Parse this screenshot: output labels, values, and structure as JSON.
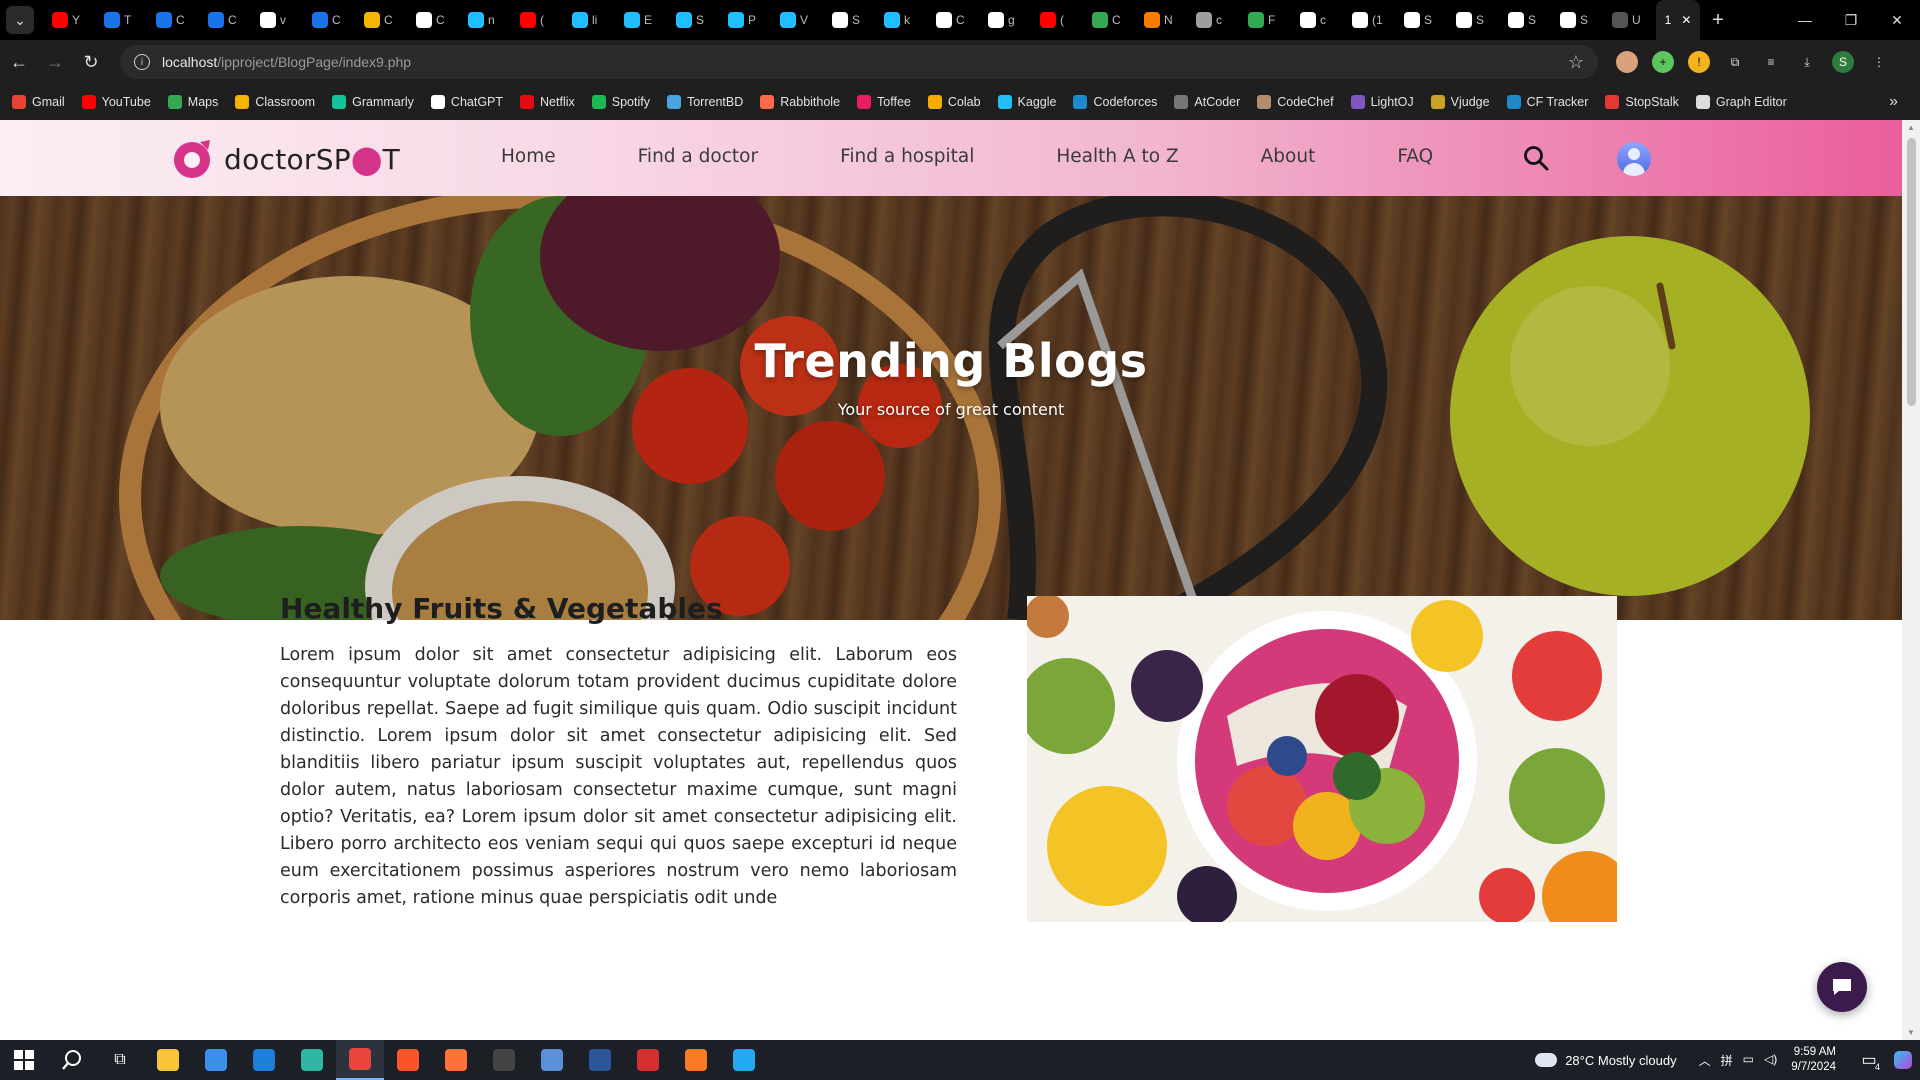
{
  "browser": {
    "tabs": [
      {
        "letter": "Y",
        "color": "#ff0000"
      },
      {
        "letter": "T",
        "color": "#1a73e8"
      },
      {
        "letter": "C",
        "color": "#1a73e8"
      },
      {
        "letter": "C",
        "color": "#1a73e8"
      },
      {
        "letter": "v",
        "color": "#ffffff"
      },
      {
        "letter": "C",
        "color": "#1a73e8"
      },
      {
        "letter": "C",
        "color": "#f4b400"
      },
      {
        "letter": "C",
        "color": "#ffffff"
      },
      {
        "letter": "n",
        "color": "#20beff"
      },
      {
        "letter": "(",
        "color": "#ff0000"
      },
      {
        "letter": "li",
        "color": "#20beff"
      },
      {
        "letter": "E",
        "color": "#20beff"
      },
      {
        "letter": "S",
        "color": "#20beff"
      },
      {
        "letter": "P",
        "color": "#20beff"
      },
      {
        "letter": "V",
        "color": "#20beff"
      },
      {
        "letter": "S",
        "color": "#ffffff"
      },
      {
        "letter": "k",
        "color": "#20beff"
      },
      {
        "letter": "C",
        "color": "#ffffff"
      },
      {
        "letter": "g",
        "color": "#ffffff"
      },
      {
        "letter": "(",
        "color": "#ff0000"
      },
      {
        "letter": "C",
        "color": "#34a853"
      },
      {
        "letter": "N",
        "color": "#f57c00"
      },
      {
        "letter": "c",
        "color": "#9e9e9e"
      },
      {
        "letter": "F",
        "color": "#34a853"
      },
      {
        "letter": "c",
        "color": "#ffffff"
      },
      {
        "letter": "(1",
        "color": "#ffffff"
      },
      {
        "letter": "S",
        "color": "#ffffff"
      },
      {
        "letter": "S",
        "color": "#ffffff"
      },
      {
        "letter": "S",
        "color": "#ffffff"
      },
      {
        "letter": "S",
        "color": "#ffffff"
      },
      {
        "letter": "U",
        "color": "#555555"
      }
    ],
    "active_tab": "1",
    "address": {
      "host": "localhost",
      "path": "/ipproject/BlogPage/index9.php"
    },
    "bookmarks": [
      {
        "label": "Gmail",
        "color": "#ea4335"
      },
      {
        "label": "YouTube",
        "color": "#ff0000"
      },
      {
        "label": "Maps",
        "color": "#34a853"
      },
      {
        "label": "Classroom",
        "color": "#f4b400"
      },
      {
        "label": "Grammarly",
        "color": "#15c39a"
      },
      {
        "label": "ChatGPT",
        "color": "#ffffff"
      },
      {
        "label": "Netflix",
        "color": "#e50914"
      },
      {
        "label": "Spotify",
        "color": "#1db954"
      },
      {
        "label": "TorrentBD",
        "color": "#4aa3df"
      },
      {
        "label": "Rabbithole",
        "color": "#ff6b4a"
      },
      {
        "label": "Toffee",
        "color": "#e91e63"
      },
      {
        "label": "Colab",
        "color": "#f9ab00"
      },
      {
        "label": "Kaggle",
        "color": "#20beff"
      },
      {
        "label": "Codeforces",
        "color": "#1f8acb"
      },
      {
        "label": "AtCoder",
        "color": "#777777"
      },
      {
        "label": "CodeChef",
        "color": "#b38b6d"
      },
      {
        "label": "LightOJ",
        "color": "#7e57c2"
      },
      {
        "label": "Vjudge",
        "color": "#c9a227"
      },
      {
        "label": "CF Tracker",
        "color": "#1f8acb"
      },
      {
        "label": "StopStalk",
        "color": "#e53935"
      },
      {
        "label": "Graph Editor",
        "color": "#dddddd"
      }
    ]
  },
  "site": {
    "logo": {
      "text_before": "doctorSP",
      "text_after": "T",
      "brand_color": "#d6338a"
    },
    "nav": [
      "Home",
      "Find a doctor",
      "Find a hospital",
      "Health A to Z",
      "About",
      "FAQ"
    ],
    "hero": {
      "title": "Trending Blogs",
      "subtitle": "Your source of great content"
    },
    "article": {
      "title": "Healthy Fruits & Vegetables",
      "body": "Lorem ipsum dolor sit amet consectetur adipisicing elit. Laborum eos consequuntur voluptate dolorum totam provident ducimus cupiditate dolore doloribus repellat. Saepe ad fugit similique quis quam. Odio suscipit incidunt distinctio. Lorem ipsum dolor sit amet consectetur adipisicing elit. Sed blanditiis libero pariatur ipsum suscipit voluptates aut, repellendus quos dolor autem, natus laboriosam consectetur maxime cumque, sunt magni optio? Veritatis, ea? Lorem ipsum dolor sit amet consectetur adipisicing elit. Libero porro architecto eos veniam sequi qui quos saepe excepturi id neque eum exercitationem possimus asperiores nostrum vero nemo laboriosam corporis amet, ratione minus quae perspiciatis odit unde"
    }
  },
  "taskbar": {
    "weather": "28°C  Mostly cloudy",
    "time": "9:59 AM",
    "date": "9/7/2024",
    "notifications": "4",
    "apps": [
      {
        "name": "file-explorer",
        "color": "#f8c43a"
      },
      {
        "name": "store",
        "color": "#3b8eea"
      },
      {
        "name": "mail",
        "color": "#1d7fd8"
      },
      {
        "name": "edge",
        "color": "#2fb5a3"
      },
      {
        "name": "chrome",
        "color": "#e8453c"
      },
      {
        "name": "brave",
        "color": "#fb542b"
      },
      {
        "name": "firefox",
        "color": "#ff7139"
      },
      {
        "name": "app",
        "color": "#444444"
      },
      {
        "name": "codeblocks",
        "color": "#5b8fd9"
      },
      {
        "name": "word",
        "color": "#2b579a"
      },
      {
        "name": "app-t",
        "color": "#d32f2f"
      },
      {
        "name": "xampp",
        "color": "#fb7a24"
      },
      {
        "name": "vscode",
        "color": "#23a9f2"
      }
    ]
  }
}
